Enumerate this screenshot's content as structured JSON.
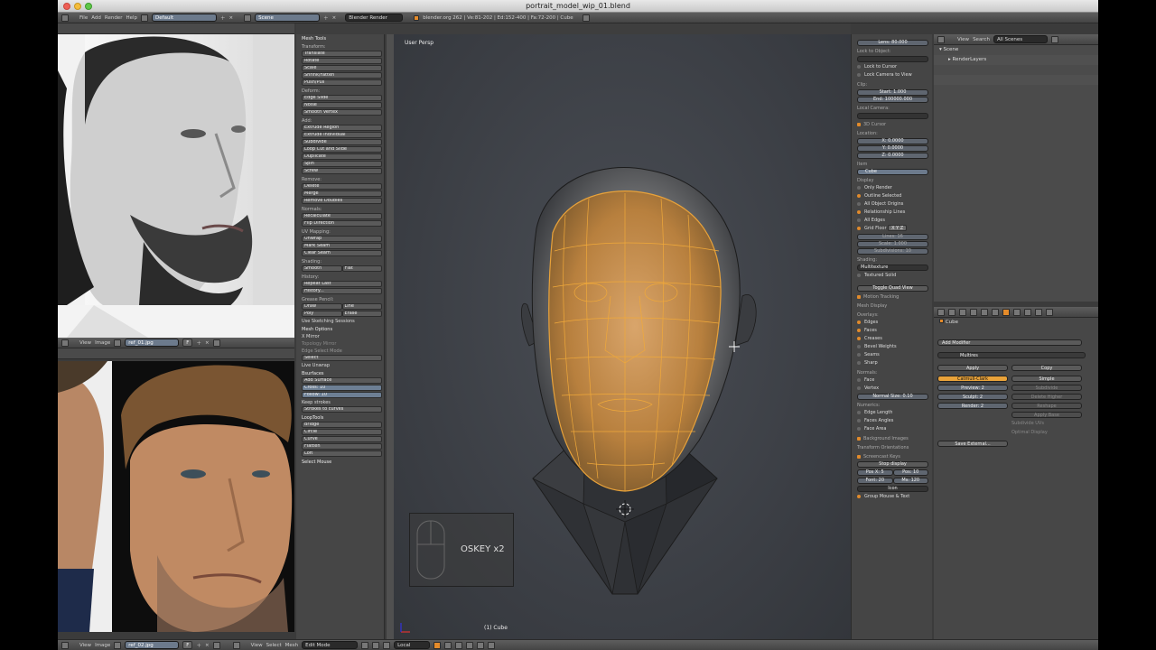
{
  "window": {
    "title": "portrait_model_wip_01.blend"
  },
  "info_header": {
    "menus": [
      "File",
      "Add",
      "Render",
      "Help"
    ],
    "layout": "Default",
    "scene": "Scene",
    "engine": "Blender Render",
    "stats": "blender.org 262 | Ve:81-202 | Ed:152-400 | Fa:72-200 | Cube"
  },
  "image_editor_1": {
    "menus": [
      "View",
      "Image"
    ],
    "image_name": "ref_01.jpg"
  },
  "image_editor_2": {
    "menus": [
      "View",
      "Image"
    ],
    "image_name": "ref_02.jpg"
  },
  "toolshelf": {
    "title": "Mesh Tools",
    "sections": [
      {
        "header": "Transform:",
        "items": [
          "Translate",
          "Rotate",
          "Scale",
          "Shrink/Fatten",
          "Push/Pull"
        ]
      },
      {
        "header": "Deform:",
        "items": [
          "Edge Slide",
          "Noise",
          "Smooth Vertex"
        ]
      },
      {
        "header": "Add:",
        "items": [
          "Extrude Region",
          "Extrude Individual",
          "Subdivide",
          "Loop Cut and Slide",
          "Duplicate",
          "Spin",
          "Screw"
        ]
      },
      {
        "header": "Remove:",
        "items": [
          "Delete",
          "Merge",
          "Remove Doubles"
        ]
      },
      {
        "header": "Normals:",
        "items": [
          "Recalculate",
          "Flip Direction"
        ]
      },
      {
        "header": "UV Mapping:",
        "items": [
          "Unwrap",
          "Mark Seam",
          "Clear Seam"
        ]
      },
      {
        "header": "Shading:",
        "items": [
          "Smooth",
          "Flat"
        ]
      },
      {
        "header": "History:",
        "items": [
          "Repeat Last",
          "History..."
        ]
      }
    ],
    "grease_pencil": {
      "header": "Grease Pencil:",
      "items": [
        "Draw",
        "Line",
        "Poly",
        "Erase"
      ],
      "sketch": "Use Sketching Sessions"
    },
    "mesh_options": {
      "header": "Mesh Options",
      "items": [
        "X Mirror",
        "Topology Mirror",
        "Edge Select Mode",
        "Select",
        "Live Unwrap"
      ]
    },
    "bsurfaces": {
      "header": "Bsurfaces",
      "items": [
        "Add Surface",
        "Cross: 10",
        "Follow: 10",
        "Keep strokes",
        "Strokes to curves"
      ]
    },
    "looptools": {
      "header": "LoopTools",
      "items": [
        "Bridge",
        "Circle",
        "Curve",
        "Flatten",
        "Loft"
      ]
    },
    "select_mouse": "Select Mouse"
  },
  "viewport": {
    "view_name": "User Persp",
    "object_label": "(1) Cube",
    "onscreen_key": "OSKEY x2",
    "accent": "#e8a23a"
  },
  "properties_panel": {
    "lens": "Lens: 80.000",
    "lock_to_object": "Lock to Object:",
    "lock_to_cursor": "Lock to Cursor",
    "lock_camera": "Lock Camera to View",
    "clip": "Clip:",
    "clip_start": "Start: 1.000",
    "clip_end": "End: 100000.000",
    "local_camera": "Local Camera:",
    "cursor_header": "3D Cursor",
    "location": "Location:",
    "x": "X: 0.0000",
    "y": "Y: 0.0000",
    "z": "Z: 0.0000",
    "item_header": "Item",
    "item_name": "Cube",
    "display_header": "Display",
    "display_items": [
      "Only Render",
      "Outline Selected",
      "All Object Origins",
      "Relationship Lines",
      "All Edges"
    ],
    "grid_floor": "Grid Floor",
    "grid_axes": "X Y Z",
    "lines": "Lines: 16",
    "scale": "Scale: 1.000",
    "subdivisions": "Subdivisions: 10",
    "shading": "Shading:",
    "shading_mode": "Multitexture",
    "textured_solid": "Textured Solid",
    "toggle_quad": "Toggle Quad View",
    "motion_tracking": "Motion Tracking",
    "mesh_display": "Mesh Display",
    "overlays": "Overlays:",
    "overlay_items": [
      "Edges",
      "Faces",
      "Creases",
      "Bevel Weights",
      "Seams",
      "Sharp"
    ],
    "normals": "Normals:",
    "normal_items": [
      "Face",
      "Vertex"
    ],
    "normal_size": "Normal Size: 0.10",
    "numerics": "Numerics:",
    "numeric_items": [
      "Edge Length",
      "Faces Angles",
      "Face Area"
    ],
    "background_images": "Background Images",
    "transform_orientations": "Transform Orientations",
    "screencast": "Screencast Keys",
    "stop_display": "Stop display",
    "pos_x": "Pos X: 5",
    "pos_y": "Pos: 10",
    "font": "Font: 20",
    "max": "Ms: 120",
    "icon": "Icon",
    "group_mouse": "Group Mouse & Text"
  },
  "outliner": {
    "menus": [
      "View",
      "Search"
    ],
    "filter": "All Scenes",
    "rows": [
      "Scene",
      "RenderLayers"
    ]
  },
  "modifiers": {
    "object": "Cube",
    "add_modifier": "Add Modifier",
    "modifier_name": "Multires",
    "apply": "Apply",
    "copy": "Copy",
    "catmull": "Catmull-Clark",
    "simple": "Simple",
    "preview": "Preview: 2",
    "sculpt": "Sculpt: 2",
    "render": "Render: 2",
    "subdivide": "Subdivide",
    "delete_higher": "Delete Higher",
    "reshape": "Reshape",
    "apply_base": "Apply Base",
    "subdivide_uvs": "Subdivide UVs",
    "optimal_display": "Optimal Display",
    "save_external": "Save External..."
  },
  "bottom_header": {
    "menus": [
      "View",
      "Select",
      "Mesh"
    ],
    "mode": "Edit Mode",
    "orientation": "Local"
  }
}
